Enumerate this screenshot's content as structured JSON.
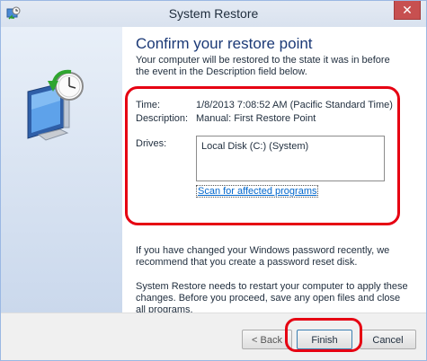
{
  "window": {
    "title": "System Restore",
    "close_label": "✕"
  },
  "heading": "Confirm your restore point",
  "intro": "Your computer will be restored to the state it was in before the event in the Description field below.",
  "details": {
    "time_label": "Time:",
    "time_value": "1/8/2013 7:08:52 AM (Pacific Standard Time)",
    "description_label": "Description:",
    "description_value": "Manual: First Restore Point",
    "drives_label": "Drives:",
    "drives": [
      "Local Disk (C:) (System)"
    ],
    "scan_link": "Scan for affected programs"
  },
  "notes": {
    "password": "If you have changed your Windows password recently, we recommend that you create a password reset disk.",
    "restart": "System Restore needs to restart your computer to apply these changes. Before you proceed, save any open files and close all programs."
  },
  "buttons": {
    "back": "< Back",
    "finish": "Finish",
    "cancel": "Cancel"
  },
  "colors": {
    "annotation": "#e60012",
    "heading": "#1c3a77",
    "link": "#0066cc"
  }
}
